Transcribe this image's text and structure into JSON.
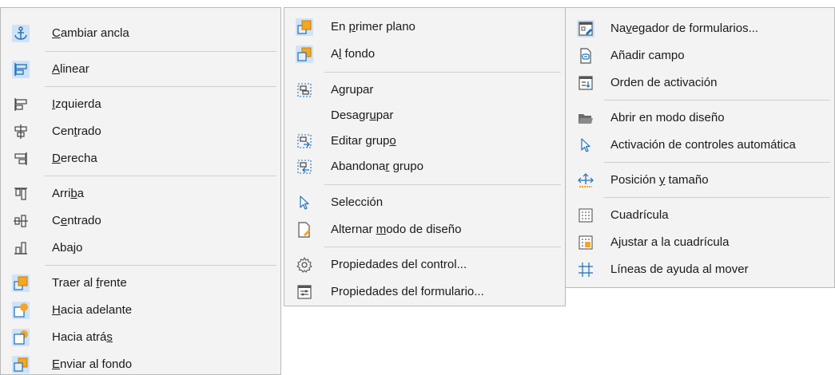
{
  "menu1": {
    "items": [
      {
        "label": "Cambiar ancla",
        "icon": "anchor-icon",
        "accel": "C"
      },
      {
        "label": "Alinear",
        "icon": "align-icon",
        "accel": "A"
      },
      {
        "label": "Izquierda",
        "icon": "align-left-icon",
        "accel": "I"
      },
      {
        "label": "Centrado",
        "icon": "align-center-horizontal-icon",
        "accel": "t"
      },
      {
        "label": "Derecha",
        "icon": "align-right-icon",
        "accel": "D"
      },
      {
        "label": "Arriba",
        "icon": "align-top-icon",
        "accel": "b"
      },
      {
        "label": "Centrado",
        "icon": "align-center-vertical-icon",
        "accel": "e"
      },
      {
        "label": "Abajo",
        "icon": "align-bottom-icon",
        "accel": ""
      },
      {
        "label": "Traer al frente",
        "icon": "bring-to-front-icon",
        "accel": "f"
      },
      {
        "label": "Hacia adelante",
        "icon": "bring-forward-icon",
        "accel": "H"
      },
      {
        "label": "Hacia atrás",
        "icon": "send-backward-icon",
        "accel": "s"
      },
      {
        "label": "Enviar al fondo",
        "icon": "send-to-back-icon",
        "accel": "E"
      }
    ]
  },
  "menu2": {
    "items": [
      {
        "label": "En primer plano",
        "icon": "foreground-icon",
        "accel": "p"
      },
      {
        "label": "Al fondo",
        "icon": "background-icon",
        "accel": "l"
      },
      {
        "label": "Agrupar",
        "icon": "group-icon",
        "accel": "g"
      },
      {
        "label": "Desagrupar",
        "icon": "",
        "accel": "u"
      },
      {
        "label": "Editar grupo",
        "icon": "edit-group-icon",
        "accel": "o"
      },
      {
        "label": "Abandonar grupo",
        "icon": "exit-group-icon",
        "accel": "r"
      },
      {
        "label": "Selección",
        "icon": "selection-arrow-icon",
        "accel": ""
      },
      {
        "label": "Alternar modo de diseño",
        "icon": "design-mode-icon",
        "accel": "m"
      },
      {
        "label": "Propiedades del control...",
        "icon": "control-properties-icon",
        "accel": ""
      },
      {
        "label": "Propiedades del formulario...",
        "icon": "form-properties-icon",
        "accel": ""
      }
    ]
  },
  "menu3": {
    "items": [
      {
        "label": "Navegador de formularios...",
        "icon": "form-navigator-icon",
        "accel": "v"
      },
      {
        "label": "Añadir campo",
        "icon": "add-field-icon",
        "accel": ""
      },
      {
        "label": "Orden de activación",
        "icon": "tab-order-icon",
        "accel": ""
      },
      {
        "label": "Abrir en modo diseño",
        "icon": "open-folder-icon",
        "accel": ""
      },
      {
        "label": "Activación de controles automática",
        "icon": "auto-control-focus-icon",
        "accel": ""
      },
      {
        "label": "Posición y tamaño",
        "icon": "position-size-icon",
        "accel": "y"
      },
      {
        "label": "Cuadrícula",
        "icon": "grid-icon",
        "accel": ""
      },
      {
        "label": "Ajustar a la cuadrícula",
        "icon": "snap-to-grid-icon",
        "accel": ""
      },
      {
        "label": "Líneas de ayuda al mover",
        "icon": "helplines-icon",
        "accel": ""
      }
    ]
  },
  "colors": {
    "menu_bg": "#f3f3f3",
    "border": "#b9b9b9",
    "separator": "#cfcfcf",
    "icon_blue": "#1e6fb8",
    "icon_highlight_bg": "#cfe2f7",
    "icon_orange": "#f5a623"
  }
}
